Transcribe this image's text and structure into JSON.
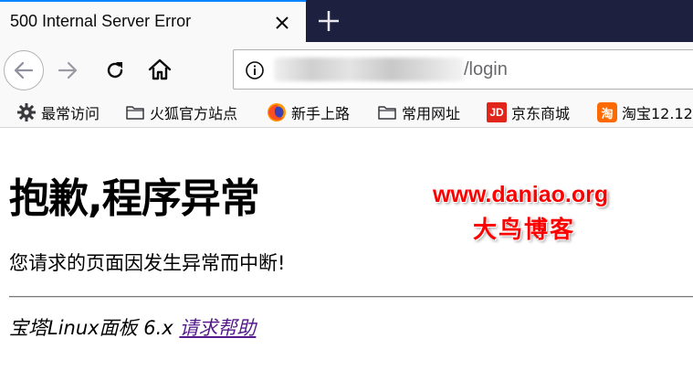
{
  "tab": {
    "title": "500 Internal Server Error"
  },
  "navbar": {
    "url_visible": "/login"
  },
  "bookmarks": [
    {
      "label": "最常访问",
      "icon": "gear-icon"
    },
    {
      "label": "火狐官方站点",
      "icon": "folder-icon"
    },
    {
      "label": "新手上路",
      "icon": "firefox-icon"
    },
    {
      "label": "常用网址",
      "icon": "folder-icon"
    },
    {
      "label": "京东商城",
      "icon": "jd-icon"
    },
    {
      "label": "淘宝12.12",
      "icon": "taobao-icon"
    }
  ],
  "page": {
    "title": "抱歉,程序异常",
    "message": "您请求的页面因发生异常而中断!",
    "footer_text": "宝塔Linux面板 6.x ",
    "help_link": "请求帮助"
  },
  "watermark": {
    "url": "www.daniao.org",
    "name": "大鸟博客"
  },
  "colors": {
    "tabstrip_bg": "#1e2040",
    "accent": "#0a84ff",
    "link_visited": "#551a8b",
    "watermark": "#ff0000"
  }
}
